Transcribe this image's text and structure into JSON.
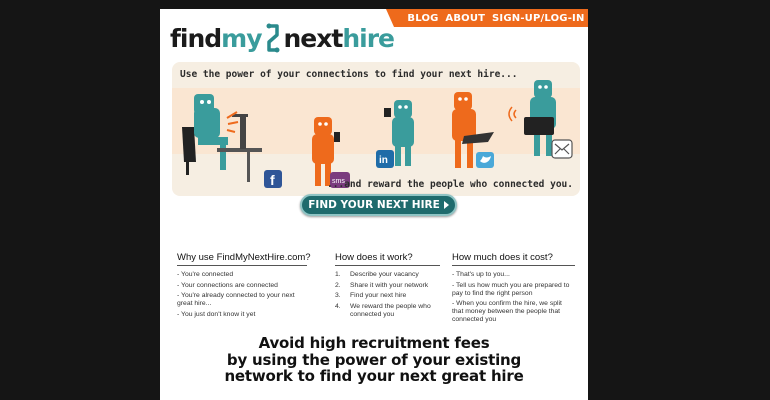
{
  "logo": {
    "part1": "find",
    "part2": "my",
    "part3": "next",
    "part4": "hire"
  },
  "nav": {
    "items": [
      "BLOG",
      "ABOUT",
      "SIGN-UP/LOG-IN"
    ]
  },
  "banner": {
    "tagline": "Use the power of your connections to find your next hire...",
    "reward": "...and reward the people who connected you."
  },
  "cta": {
    "label": "FIND YOUR NEXT HIRE"
  },
  "why": {
    "heading": "Why use FindMyNextHire.com?",
    "items": [
      "- You're connected",
      "- Your connections are connected",
      "- You're already connected to your next great hire...",
      "- You just don't know it yet"
    ]
  },
  "how": {
    "heading": "How does it work?",
    "numbers": [
      "1.",
      "2.",
      "3.",
      "4."
    ],
    "items": [
      "Describe your vacancy",
      "Share it with your network",
      "Find your next hire",
      "We reward the people who connected you"
    ]
  },
  "cost": {
    "heading": "How much does it cost?",
    "items": [
      "- That's up to you...",
      "- Tell us how much you are prepared to pay to find the right person",
      "- When you confirm the hire, we split that money between the people that connected you"
    ]
  },
  "bottom": {
    "lines": [
      "Avoid high recruitment fees",
      "by using the power of your existing",
      "network to find your next great hire"
    ]
  },
  "icons": {
    "facebook": "f",
    "linkedin": "in",
    "sms": "sms",
    "twitter": "twitter-bird-icon",
    "email": "envelope-icon"
  },
  "colors": {
    "accent": "#ee6a1c",
    "teal": "#3a9c9c",
    "cta": "#1f6b6d"
  }
}
